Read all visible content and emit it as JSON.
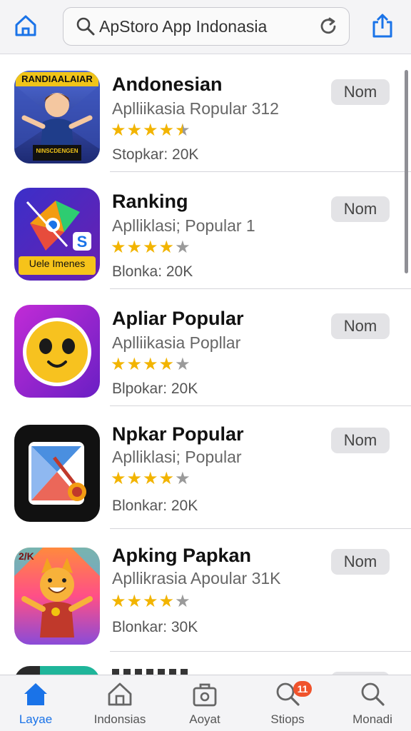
{
  "colors": {
    "accent": "#1a73e8",
    "star": "#f2b400",
    "badge": "#f0532c"
  },
  "toolbar": {
    "home_icon": "home-icon",
    "search_text": "ApStoro  App Indonasia",
    "reload_icon": "reload-icon",
    "share_icon": "share-icon"
  },
  "apps": [
    {
      "name": "Andonesian",
      "subtitle": "Aplliikasia Ropular 312",
      "rating": 4.5,
      "downloads": "Stopkar: 20K",
      "button": "Nom",
      "icon_text": "RANDIAALAIAR",
      "icon_banner": "NINSCDENGEN"
    },
    {
      "name": "Ranking",
      "subtitle": "Aplliklasi; Popular 1",
      "rating": 4,
      "downloads": "Blonka: 20K",
      "button": "Nom",
      "icon_text": "Uele Imenes"
    },
    {
      "name": "Apliar Popular",
      "subtitle": "Aplliikasia Popllar",
      "rating": 4,
      "downloads": "Blpokar: 20K",
      "button": "Nom"
    },
    {
      "name": "Npkar Popular",
      "subtitle": "Aplliklasi; Popular",
      "rating": 4,
      "downloads": "Blonkar: 20K",
      "button": "Nom"
    },
    {
      "name": "Apking Papkan",
      "subtitle": "Apllikrasia Apoular 31K",
      "rating": 4,
      "downloads": "Blonkar: 30K",
      "button": "Nom",
      "icon_text": "2/K"
    }
  ],
  "tabs": [
    {
      "label": "Layae",
      "icon": "home-icon",
      "active": true
    },
    {
      "label": "Indonsias",
      "icon": "apps-home-icon"
    },
    {
      "label": "Aoyat",
      "icon": "bag-icon"
    },
    {
      "label": "Stiops",
      "icon": "updates-icon",
      "badge": "11"
    },
    {
      "label": "Monadi",
      "icon": "search-icon"
    }
  ]
}
